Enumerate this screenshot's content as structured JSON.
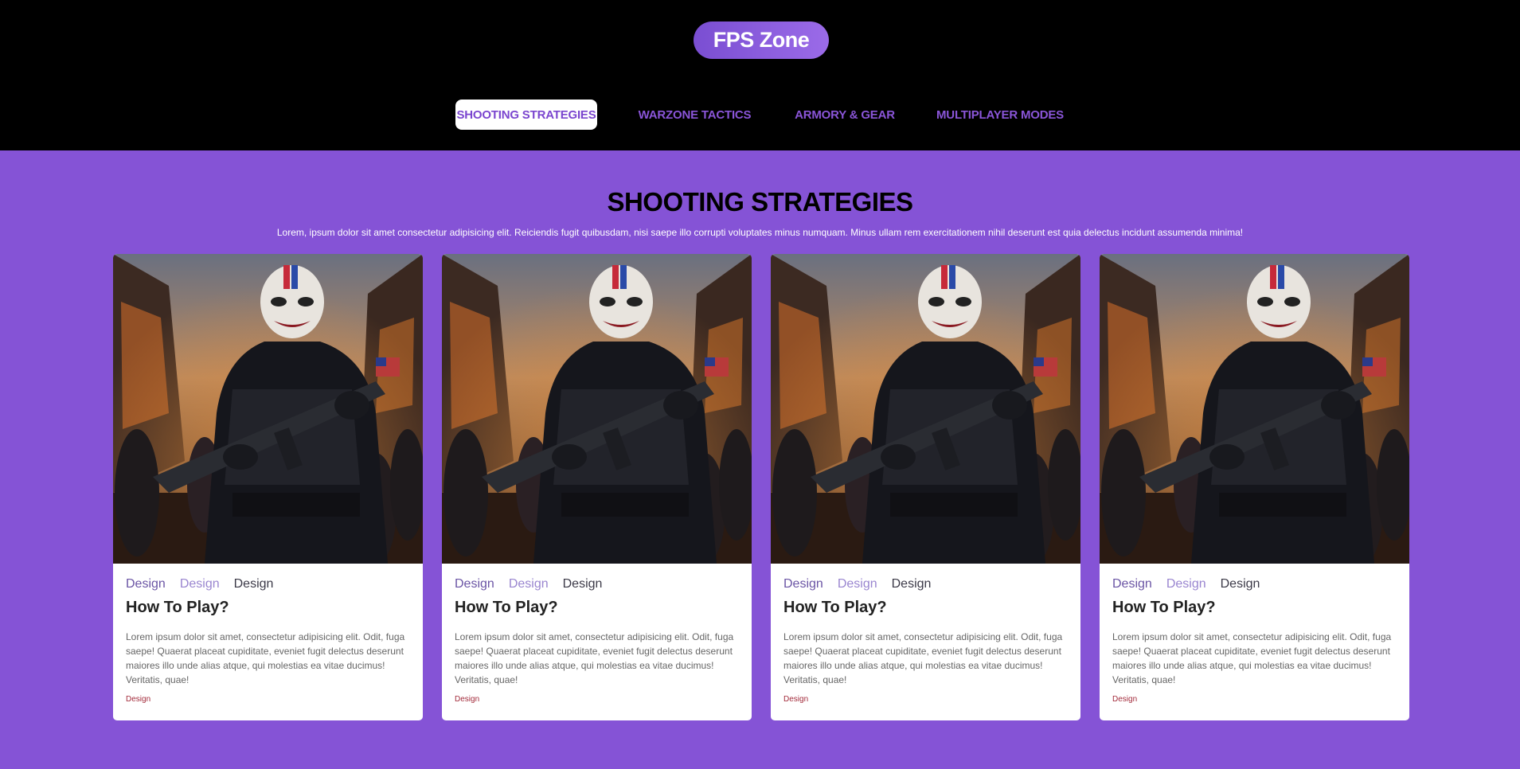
{
  "header": {
    "brand": "FPS Zone",
    "nav": [
      {
        "label": "SHOOTING STRATEGIES",
        "active": true
      },
      {
        "label": "WARZONE TACTICS",
        "active": false
      },
      {
        "label": "ARMORY & GEAR",
        "active": false
      },
      {
        "label": "MULTIPLAYER MODES",
        "active": false
      }
    ]
  },
  "section": {
    "title": "SHOOTING STRATEGIES",
    "description": "Lorem, ipsum dolor sit amet consectetur adipisicing elit. Reiciendis fugit quibusdam, nisi saepe illo corrupti voluptates minus numquam. Minus ullam rem exercitationem nihil deserunt est quia delectus incidunt assumenda minima!"
  },
  "cards": [
    {
      "tags": [
        "Design",
        "Design",
        "Design"
      ],
      "title": "How To Play?",
      "text": "Lorem ipsum dolor sit amet, consectetur adipisicing elit. Odit, fuga saepe! Quaerat placeat cupiditate, eveniet fugit delectus deserunt maiores illo unde alias atque, qui molestias ea vitae ducimus! Veritatis, quae!",
      "link": "Design"
    },
    {
      "tags": [
        "Design",
        "Design",
        "Design"
      ],
      "title": "How To Play?",
      "text": "Lorem ipsum dolor sit amet, consectetur adipisicing elit. Odit, fuga saepe! Quaerat placeat cupiditate, eveniet fugit delectus deserunt maiores illo unde alias atque, qui molestias ea vitae ducimus! Veritatis, quae!",
      "link": "Design"
    },
    {
      "tags": [
        "Design",
        "Design",
        "Design"
      ],
      "title": "How To Play?",
      "text": "Lorem ipsum dolor sit amet, consectetur adipisicing elit. Odit, fuga saepe! Quaerat placeat cupiditate, eveniet fugit delectus deserunt maiores illo unde alias atque, qui molestias ea vitae ducimus! Veritatis, quae!",
      "link": "Design"
    },
    {
      "tags": [
        "Design",
        "Design",
        "Design"
      ],
      "title": "How To Play?",
      "text": "Lorem ipsum dolor sit amet, consectetur adipisicing elit. Odit, fuga saepe! Quaerat placeat cupiditate, eveniet fugit delectus deserunt maiores illo unde alias atque, qui molestias ea vitae ducimus! Veritatis, quae!",
      "link": "Design"
    }
  ],
  "colors": {
    "accent": "#8553d6",
    "nav_text": "#8a55d8",
    "link": "#a22a3a"
  },
  "icons": {
    "card_image": "masked-soldier-illustration"
  }
}
